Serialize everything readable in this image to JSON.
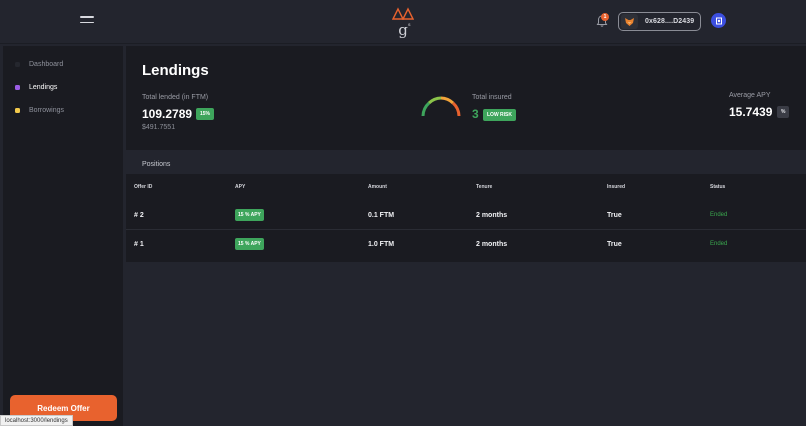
{
  "header": {
    "notification_count": "1",
    "wallet_address": "0x628....D2439",
    "colors": {
      "accent": "#e8622e",
      "avatar": "#3c4fe0"
    }
  },
  "sidebar": {
    "items": [
      {
        "label": "Dashboard",
        "color": "#25272e"
      },
      {
        "label": "Lendings",
        "color": "#9b5de5"
      },
      {
        "label": "Borrowings",
        "color": "#f2c94c"
      }
    ],
    "redeem_label": "Redeem Offer"
  },
  "status_url": "localhost:3000/lendings",
  "summary": {
    "title": "Lendings",
    "total_lended_label": "Total lended (in FTM)",
    "total_lended_value": "109.2789",
    "total_lended_badge": "15%",
    "total_lended_usd": "$491.7551",
    "total_insured_label": "Total insured",
    "total_insured_value": "3",
    "risk_badge": "LOW RISK",
    "avg_apy_label": "Average APY",
    "avg_apy_value": "15.7439",
    "avg_apy_unit": "%"
  },
  "positions": {
    "label": "Positions",
    "columns": [
      "Offer ID",
      "APY",
      "Amount",
      "Tenure",
      "Insured",
      "Status"
    ],
    "rows": [
      {
        "id": "# 2",
        "apy": "15 % APY",
        "amount": "0.1 FTM",
        "tenure": "2 months",
        "insured": "True",
        "status": "Ended"
      },
      {
        "id": "# 1",
        "apy": "15 % APY",
        "amount": "1.0 FTM",
        "tenure": "2 months",
        "insured": "True",
        "status": "Ended"
      }
    ]
  }
}
